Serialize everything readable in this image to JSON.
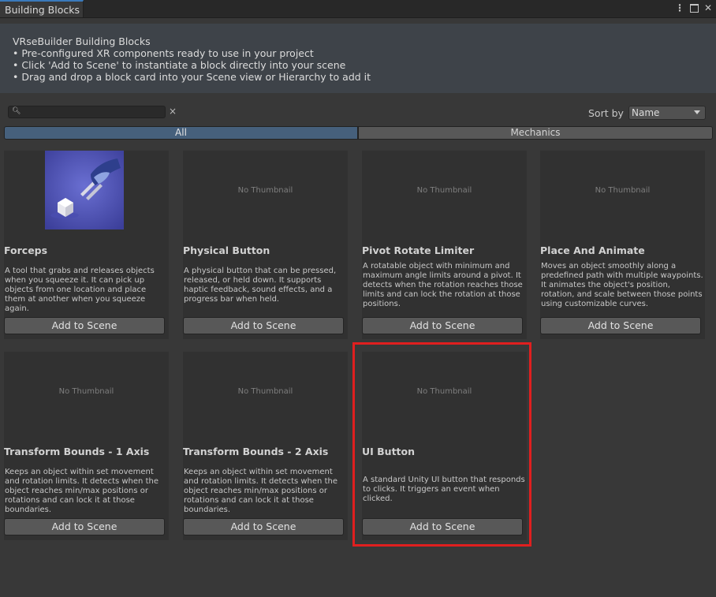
{
  "window": {
    "tab_label": "Building Blocks",
    "menu_icon": "kebab-menu-icon",
    "maximize_icon": "maximize-icon",
    "close_icon": "close-icon",
    "close_glyph": "✕"
  },
  "header": {
    "title": "VRseBuilder Building Blocks",
    "lines": [
      "• Pre-configured XR components ready to use in your project",
      "• Click 'Add to Scene' to instantiate a block directly into your scene",
      "• Drag and drop a block card into your Scene view or Hierarchy to add it"
    ]
  },
  "search": {
    "value": "",
    "placeholder": "",
    "clear_glyph": "×"
  },
  "sort": {
    "label": "Sort by",
    "selected": "Name"
  },
  "tabs": [
    {
      "label": "All",
      "active": true
    },
    {
      "label": "Mechanics",
      "active": false
    }
  ],
  "cards": [
    {
      "title": "Forceps",
      "thumbnail": "forceps-image",
      "description": "A tool that grabs and releases objects when you squeeze it. It can pick up objects from one location and place them at another when you squeeze again.",
      "button": "Add to Scene"
    },
    {
      "title": "Physical Button",
      "thumbnail_text": "No Thumbnail",
      "description": "A physical button that can be pressed, released, or held down. It supports haptic feedback, sound effects, and a progress bar when held.",
      "button": "Add to Scene"
    },
    {
      "title": "Pivot Rotate Limiter",
      "thumbnail_text": "No Thumbnail",
      "description": "A rotatable object with minimum and maximum angle limits around a pivot. It detects when the rotation reaches those limits and can lock the rotation at those positions.",
      "button": "Add to Scene"
    },
    {
      "title": "Place And Animate",
      "thumbnail_text": "No Thumbnail",
      "description": "Moves an object smoothly along a predefined path with multiple waypoints. It animates the object's position, rotation, and scale between those points using customizable curves.",
      "button": "Add to Scene"
    },
    {
      "title": "Transform Bounds - 1 Axis",
      "thumbnail_text": "No Thumbnail",
      "description": "Keeps an object within set movement and rotation limits. It detects when the object reaches min/max positions or rotations and can lock it at those boundaries.",
      "button": "Add to Scene"
    },
    {
      "title": "Transform Bounds - 2 Axis",
      "thumbnail_text": "No Thumbnail",
      "description": "Keeps an object within set movement and rotation limits. It detects when the object reaches min/max positions or rotations and can lock it at those boundaries.",
      "button": "Add to Scene"
    },
    {
      "title": "UI Button",
      "thumbnail_text": "No Thumbnail",
      "description": "A standard Unity UI button that responds to clicks. It triggers an event when clicked.",
      "button": "Add to Scene",
      "highlighted": true
    }
  ],
  "colors": {
    "highlight": "#e01f1f",
    "active_tab": "#46607c",
    "tab_accent": "#3a79bb"
  }
}
